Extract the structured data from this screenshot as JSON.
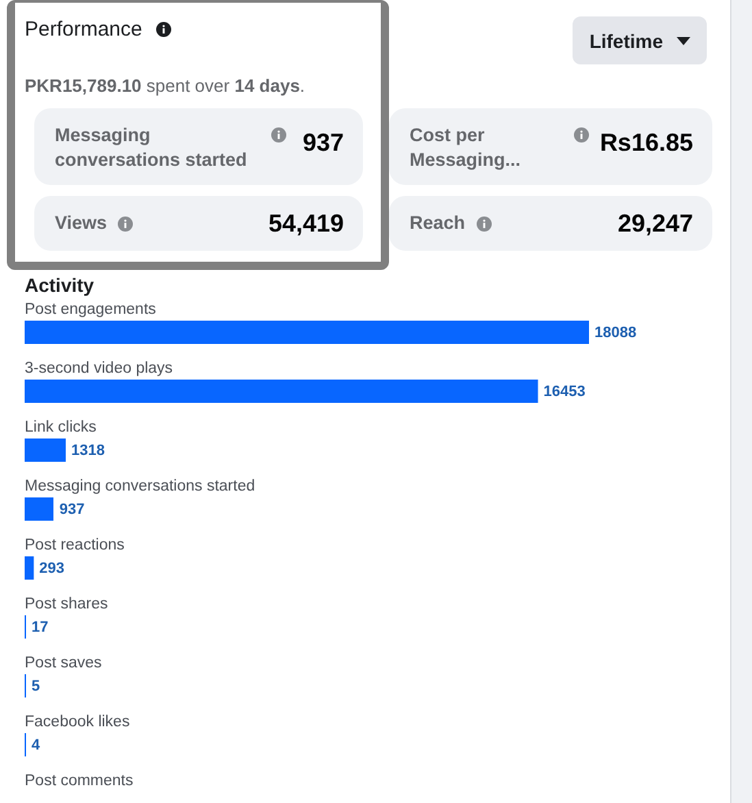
{
  "header": {
    "title": "Performance",
    "period_button": "Lifetime"
  },
  "spend_summary": "**PKR15,789.10** spent over **14 days**.",
  "metrics": [
    {
      "label": "Messaging conversations started",
      "value": "937"
    },
    {
      "label": "Cost per Messaging...",
      "value": "Rs16.85"
    },
    {
      "label": "Views",
      "value": "54,419"
    },
    {
      "label": "Reach",
      "value": "29,247"
    }
  ],
  "activity": {
    "title": "Activity",
    "chart_data": {
      "type": "bar",
      "orientation": "horizontal",
      "data_labels": true,
      "categories": [
        "Post engagements",
        "3-second video plays",
        "Link clicks",
        "Messaging conversations started",
        "Post reactions",
        "Post shares",
        "Post saves",
        "Facebook likes",
        "Post comments"
      ],
      "values": [
        18088,
        16453,
        1318,
        937,
        293,
        17,
        5,
        4,
        null
      ]
    }
  }
}
